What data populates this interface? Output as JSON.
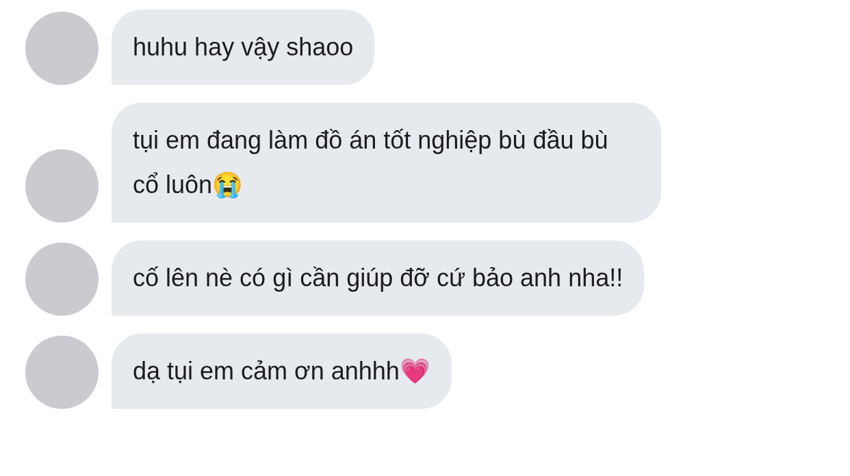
{
  "messages": [
    {
      "text": "huhu hay vậy shaoo"
    },
    {
      "text": "tụi em đang làm đồ án tốt nghiệp bù đầu bù cổ luôn😭"
    },
    {
      "text": "cố lên nè có gì cần giúp đỡ cứ bảo anh nha!!"
    },
    {
      "text": "dạ tụi em cảm ơn anhhh💗"
    }
  ]
}
